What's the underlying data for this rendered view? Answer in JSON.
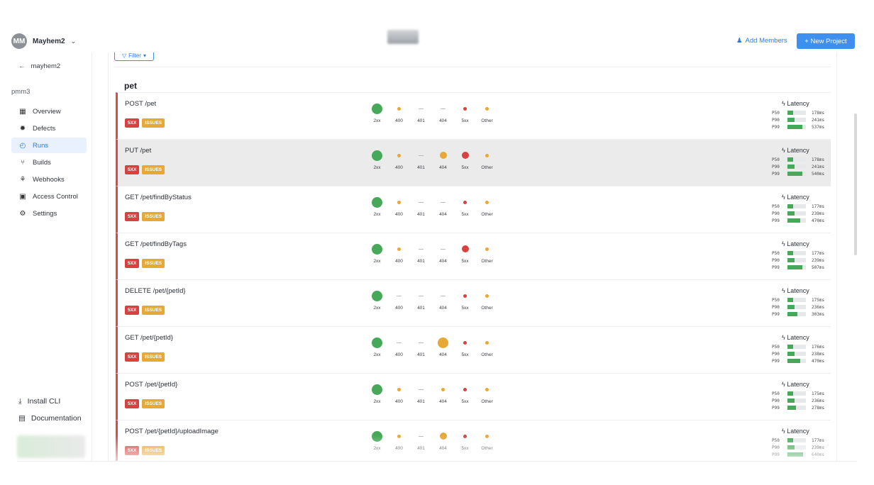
{
  "header": {
    "avatar_initials": "MM",
    "workspace": "Mayhem2",
    "add_members": "Add Members",
    "new_project": "+ New Project"
  },
  "sidebar": {
    "back_label": "mayhem2",
    "project": "pmm3",
    "items": [
      {
        "label": "Overview",
        "icon": "grid-icon",
        "active": false
      },
      {
        "label": "Defects",
        "icon": "bug-icon",
        "active": false
      },
      {
        "label": "Runs",
        "icon": "stopwatch-icon",
        "active": true
      },
      {
        "label": "Builds",
        "icon": "branch-icon",
        "active": false
      },
      {
        "label": "Webhooks",
        "icon": "webhook-icon",
        "active": false
      },
      {
        "label": "Access Control",
        "icon": "lock-icon",
        "active": false
      },
      {
        "label": "Settings",
        "icon": "gear-icon",
        "active": false
      }
    ],
    "install_cli": "Install CLI",
    "documentation": "Documentation"
  },
  "main": {
    "filter": "Filter",
    "group": "pet",
    "code_labels": [
      "2xx",
      "400",
      "401",
      "404",
      "5xx",
      "Other"
    ],
    "tag_5xx": "5XX",
    "tag_issues": "ISSUES",
    "latency_title": "Latency",
    "latency_keys": [
      "P50",
      "P90",
      "P99"
    ],
    "colors": {
      "green": "#46a858",
      "orange": "#e7a836",
      "red": "#d94040"
    },
    "endpoints": [
      {
        "path": "POST /pet",
        "highlight": false,
        "dots": [
          [
            "green",
            "l"
          ],
          [
            "orange",
            "s"
          ],
          [
            "none",
            ""
          ],
          [
            "none",
            ""
          ],
          [
            "red",
            "s"
          ],
          [
            "orange",
            "s"
          ]
        ],
        "latency": [
          {
            "v": "178ms",
            "f": 0.3
          },
          {
            "v": "241ms",
            "f": 0.38
          },
          {
            "v": "537ms",
            "f": 0.8
          }
        ]
      },
      {
        "path": "PUT /pet",
        "highlight": true,
        "dots": [
          [
            "green",
            "l"
          ],
          [
            "orange",
            "s"
          ],
          [
            "none",
            ""
          ],
          [
            "orange",
            "m"
          ],
          [
            "red",
            "m"
          ],
          [
            "orange",
            "s"
          ]
        ],
        "latency": [
          {
            "v": "178ms",
            "f": 0.3
          },
          {
            "v": "241ms",
            "f": 0.38
          },
          {
            "v": "540ms",
            "f": 0.8
          }
        ]
      },
      {
        "path": "GET /pet/findByStatus",
        "highlight": false,
        "dots": [
          [
            "green",
            "l"
          ],
          [
            "orange",
            "s"
          ],
          [
            "none",
            ""
          ],
          [
            "none",
            ""
          ],
          [
            "red",
            "xs"
          ],
          [
            "orange",
            "s"
          ]
        ],
        "latency": [
          {
            "v": "177ms",
            "f": 0.3
          },
          {
            "v": "239ms",
            "f": 0.38
          },
          {
            "v": "470ms",
            "f": 0.7
          }
        ]
      },
      {
        "path": "GET /pet/findByTags",
        "highlight": false,
        "dots": [
          [
            "green",
            "l"
          ],
          [
            "orange",
            "s"
          ],
          [
            "none",
            ""
          ],
          [
            "none",
            ""
          ],
          [
            "red",
            "m"
          ],
          [
            "orange",
            "s"
          ]
        ],
        "latency": [
          {
            "v": "177ms",
            "f": 0.3
          },
          {
            "v": "239ms",
            "f": 0.38
          },
          {
            "v": "507ms",
            "f": 0.8
          }
        ]
      },
      {
        "path": "DELETE /pet/{petId}",
        "highlight": false,
        "dots": [
          [
            "green",
            "l"
          ],
          [
            "none",
            ""
          ],
          [
            "none",
            ""
          ],
          [
            "none",
            ""
          ],
          [
            "red",
            "xs"
          ],
          [
            "orange",
            "s"
          ]
        ],
        "latency": [
          {
            "v": "175ms",
            "f": 0.3
          },
          {
            "v": "236ms",
            "f": 0.38
          },
          {
            "v": "303ms",
            "f": 0.55
          }
        ]
      },
      {
        "path": "GET /pet/{petId}",
        "highlight": false,
        "dots": [
          [
            "green",
            "l"
          ],
          [
            "none",
            ""
          ],
          [
            "none",
            ""
          ],
          [
            "orange",
            "l"
          ],
          [
            "red",
            "xs"
          ],
          [
            "orange",
            "s"
          ]
        ],
        "latency": [
          {
            "v": "176ms",
            "f": 0.3
          },
          {
            "v": "238ms",
            "f": 0.38
          },
          {
            "v": "470ms",
            "f": 0.7
          }
        ]
      },
      {
        "path": "POST /pet/{petId}",
        "highlight": false,
        "dots": [
          [
            "green",
            "l"
          ],
          [
            "orange",
            "s"
          ],
          [
            "none",
            ""
          ],
          [
            "orange",
            "s"
          ],
          [
            "red",
            "xs"
          ],
          [
            "orange",
            "xs"
          ]
        ],
        "latency": [
          {
            "v": "175ms",
            "f": 0.3
          },
          {
            "v": "236ms",
            "f": 0.38
          },
          {
            "v": "278ms",
            "f": 0.45
          }
        ]
      },
      {
        "path": "POST /pet/{petId}/uploadImage",
        "highlight": false,
        "dots": [
          [
            "green",
            "l"
          ],
          [
            "orange",
            "xs"
          ],
          [
            "none",
            ""
          ],
          [
            "orange",
            "m"
          ],
          [
            "red",
            "s"
          ],
          [
            "orange",
            "xs"
          ]
        ],
        "latency": [
          {
            "v": "177ms",
            "f": 0.3
          },
          {
            "v": "239ms",
            "f": 0.38
          },
          {
            "v": "640ms",
            "f": 0.85
          }
        ]
      }
    ]
  }
}
